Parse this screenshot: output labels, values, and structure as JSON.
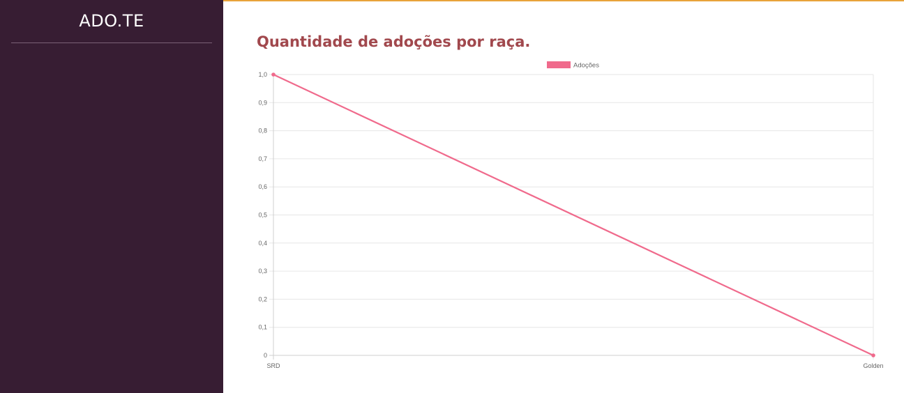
{
  "app": {
    "brand": "ADO.TE"
  },
  "page": {
    "title": "Quantidade de adoções por raça."
  },
  "colors": {
    "sidebar": "#371d33",
    "title": "#a1484d",
    "accent": "#e8a33a",
    "series": "#f06a8c"
  },
  "chart_data": {
    "type": "line",
    "categories": [
      "SRD",
      "Golden"
    ],
    "series": [
      {
        "name": "Adoções",
        "values": [
          1,
          0
        ]
      }
    ],
    "ylim": [
      0,
      1
    ],
    "yticks": [
      "0",
      "0,1",
      "0,2",
      "0,3",
      "0,4",
      "0,5",
      "0,6",
      "0,7",
      "0,8",
      "0,9",
      "1,0"
    ],
    "legend": "top-center",
    "grid": true
  }
}
